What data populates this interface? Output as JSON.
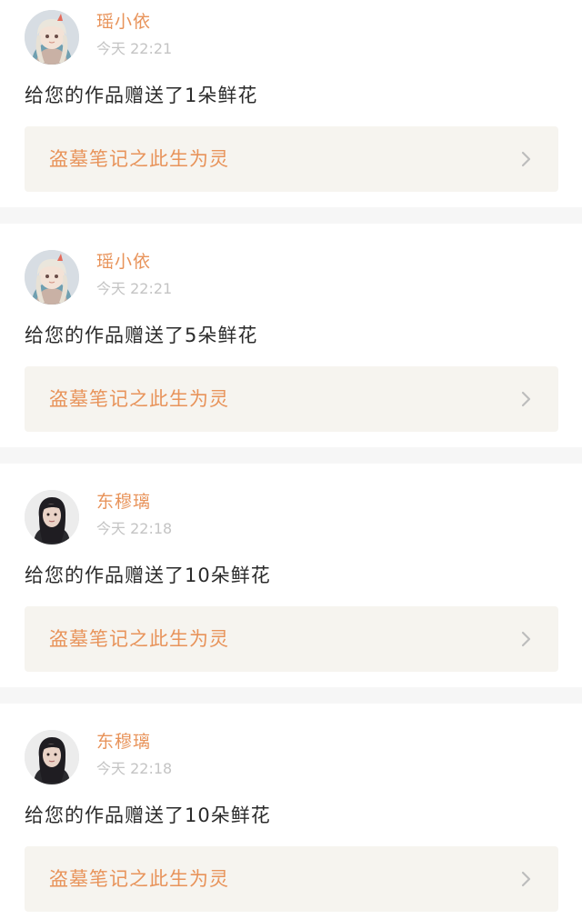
{
  "notifications": [
    {
      "user": "瑶小依",
      "avatar": "anime-girl-avatar",
      "time": "今天 22:21",
      "message": "给您的作品赠送了1朵鲜花",
      "work_title": "盗墓笔记之此生为灵"
    },
    {
      "user": "瑶小依",
      "avatar": "anime-girl-avatar",
      "time": "今天 22:21",
      "message": "给您的作品赠送了5朵鲜花",
      "work_title": "盗墓笔记之此生为灵"
    },
    {
      "user": "东穆璃",
      "avatar": "photo-girl-avatar",
      "time": "今天 22:18",
      "message": "给您的作品赠送了10朵鲜花",
      "work_title": "盗墓笔记之此生为灵"
    },
    {
      "user": "东穆璃",
      "avatar": "photo-girl-avatar",
      "time": "今天 22:18",
      "message": "给您的作品赠送了10朵鲜花",
      "work_title": "盗墓笔记之此生为灵"
    }
  ],
  "colors": {
    "username": "#e8935a",
    "time": "#c4c4c4",
    "message": "#2b2b2b",
    "link_bg": "#f6f4ef",
    "separator": "#f6f6f6"
  },
  "icons": {
    "chevron": "chevron-right-icon"
  }
}
